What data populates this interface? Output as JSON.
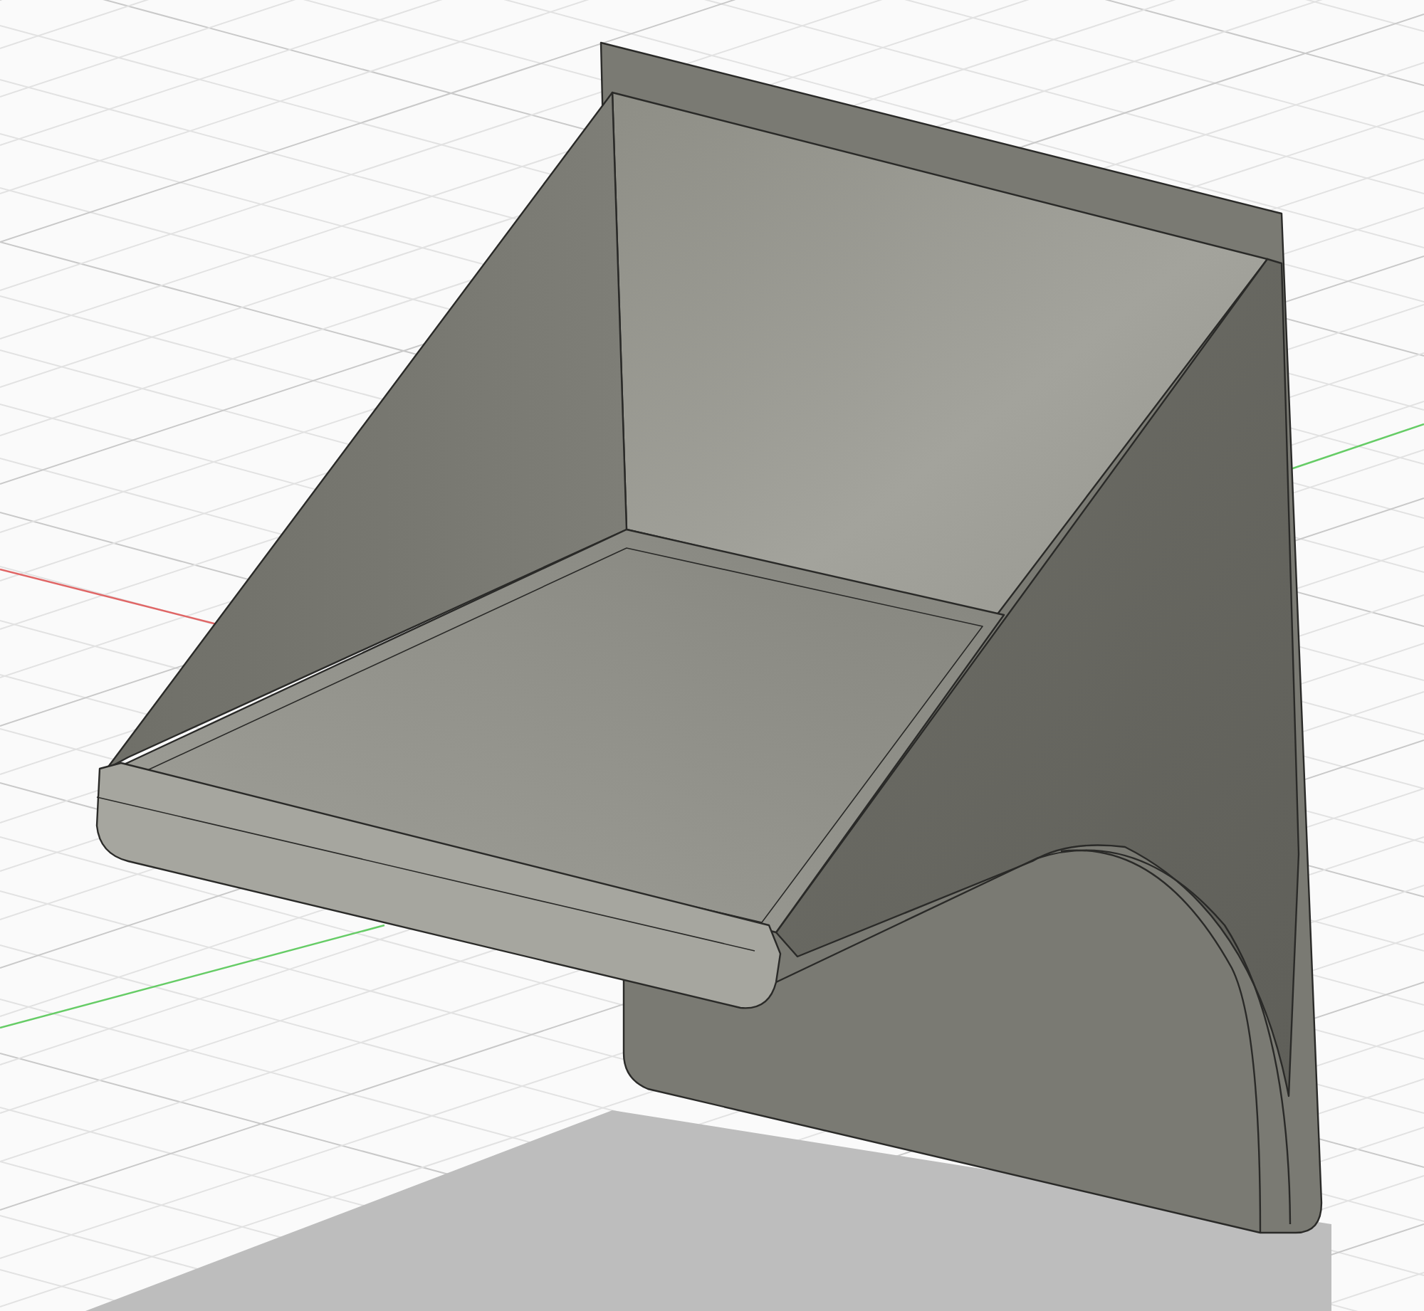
{
  "viewport": {
    "axes": [
      {
        "kind": "x",
        "color": "#e06666"
      },
      {
        "kind": "y",
        "color": "#66cc66"
      }
    ]
  }
}
